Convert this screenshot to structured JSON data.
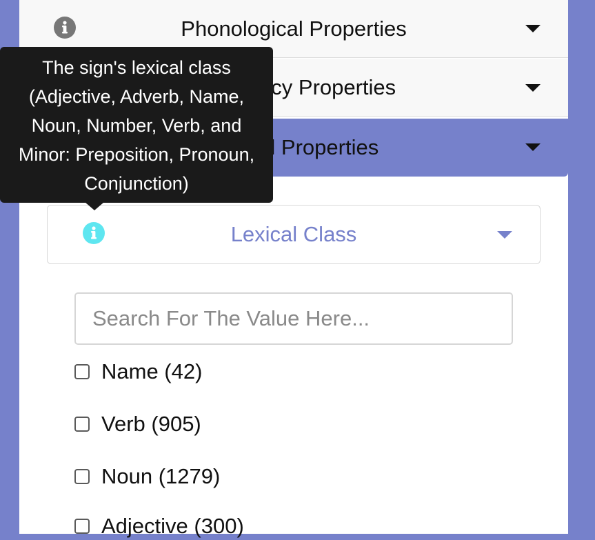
{
  "accordion": {
    "items": [
      {
        "label": "Phonological Properties"
      },
      {
        "label": "Frequency Properties"
      },
      {
        "label": "Lexical Properties"
      }
    ]
  },
  "lexical_class": {
    "title": "Lexical Class",
    "tooltip_lines": [
      "The sign's lexical class",
      "(Adjective, Adverb, Name,",
      "Noun, Number, Verb, and",
      "Minor: Preposition, Pronoun,",
      "Conjunction)"
    ],
    "search_placeholder": "Search For The Value Here...",
    "options": [
      {
        "label": "Name (42)",
        "checked": false
      },
      {
        "label": "Verb (905)",
        "checked": false
      },
      {
        "label": "Noun (1279)",
        "checked": false
      },
      {
        "label": "Adjective (300)",
        "checked": false
      }
    ]
  },
  "colors": {
    "accent": "#7681cb",
    "info_icon_gray": "#777777",
    "info_icon_cyan": "#5ee6f0",
    "tooltip_bg": "#1a1a1a"
  }
}
